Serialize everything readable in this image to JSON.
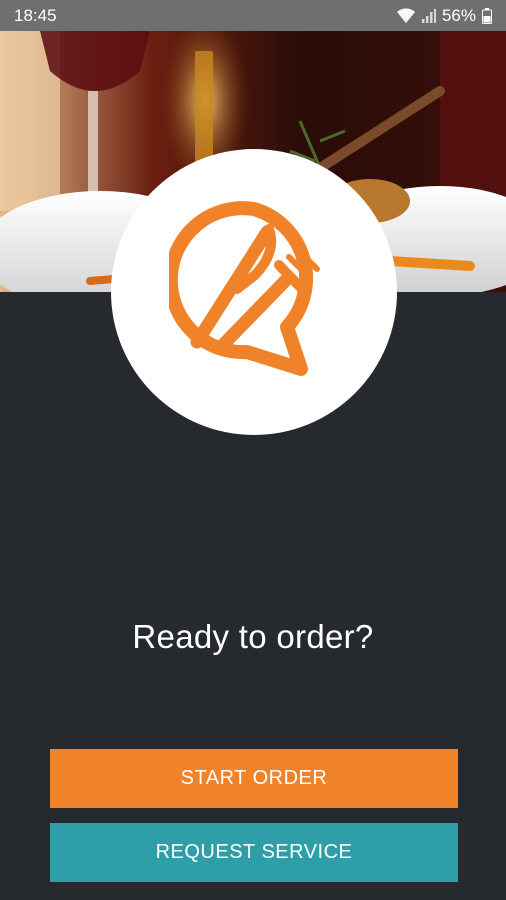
{
  "status_bar": {
    "time": "18:45",
    "battery_percent": "56%",
    "icons": [
      "wifi-icon",
      "signal-icon",
      "battery-icon"
    ]
  },
  "hero": {
    "image": "restaurant-dinner-table-photo"
  },
  "logo": {
    "icon": "fork-knife-chat-bubble-icon",
    "color": "#f0832a"
  },
  "main": {
    "prompt": "Ready to order?"
  },
  "buttons": {
    "start_order": "START ORDER",
    "request_service": "REQUEST SERVICE"
  },
  "colors": {
    "background": "#262a2e",
    "primary": "#f0832a",
    "secondary": "#2e9fa8",
    "status_bar": "#6f6f6f"
  }
}
